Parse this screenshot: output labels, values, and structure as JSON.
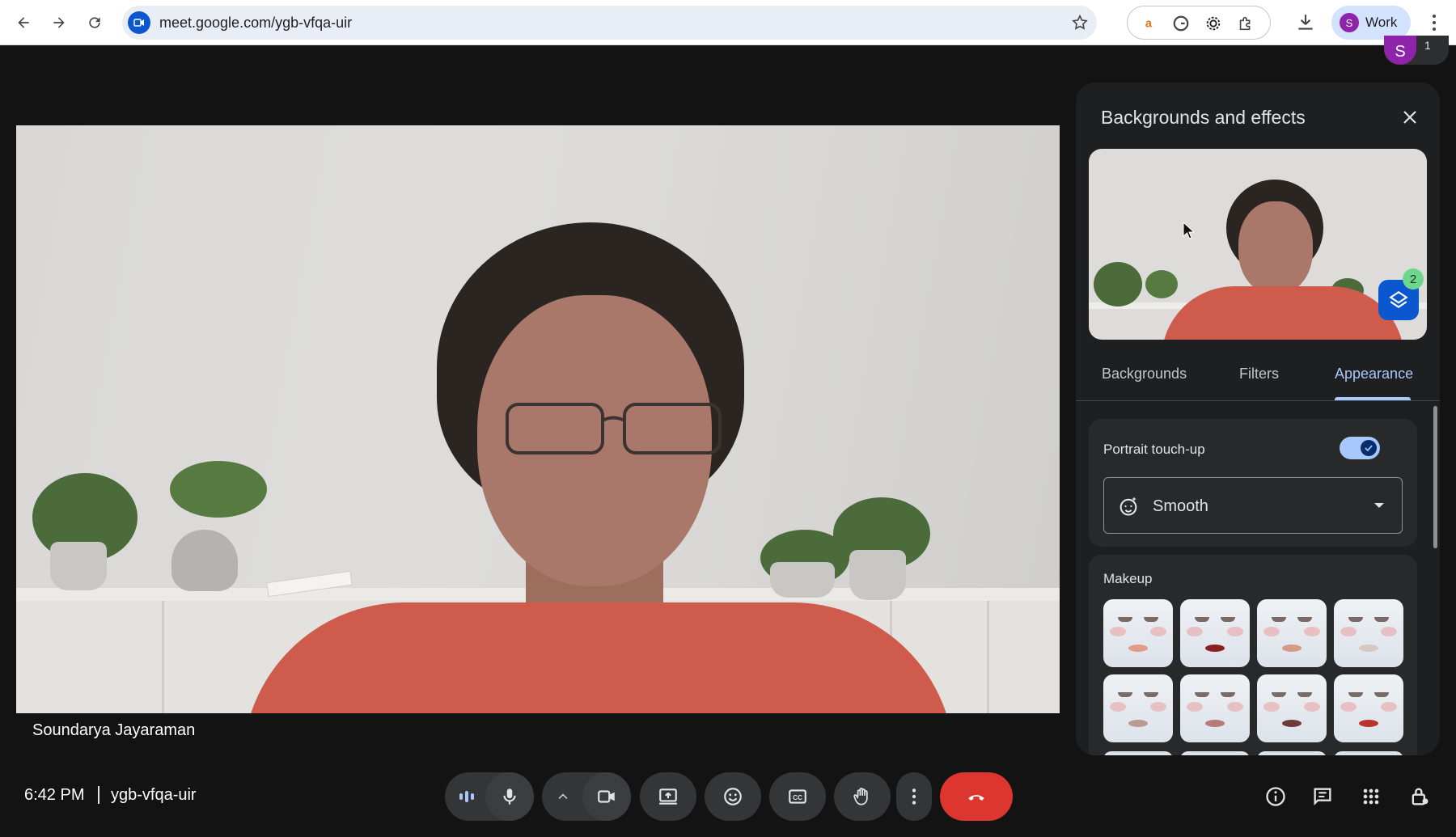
{
  "browser": {
    "url": "meet.google.com/ygb-vfqa-uir",
    "profile_initial": "S",
    "profile_label": "Work"
  },
  "meet": {
    "top_avatar_initial": "S",
    "top_avatar_count": "1",
    "participant_name": "Soundarya Jayaraman",
    "time": "6:42 PM",
    "meeting_code": "ygb-vfqa-uir"
  },
  "panel": {
    "title": "Backgrounds and effects",
    "effects_count": "2",
    "tabs": [
      {
        "label": "Backgrounds",
        "active": false
      },
      {
        "label": "Filters",
        "active": false
      },
      {
        "label": "Appearance",
        "active": true
      }
    ],
    "portrait": {
      "label": "Portrait touch-up",
      "enabled": true,
      "selected": "Smooth"
    },
    "makeup": {
      "label": "Makeup",
      "lip_colors": [
        "#e29b86",
        "#8a1f24",
        "#d49a86",
        "#d8c7c2",
        "#b89a92",
        "#b87a78",
        "#6e3c38",
        "#b8352e"
      ]
    }
  },
  "colors": {
    "end_call": "#dc362e",
    "accent": "#a8c7fa"
  }
}
